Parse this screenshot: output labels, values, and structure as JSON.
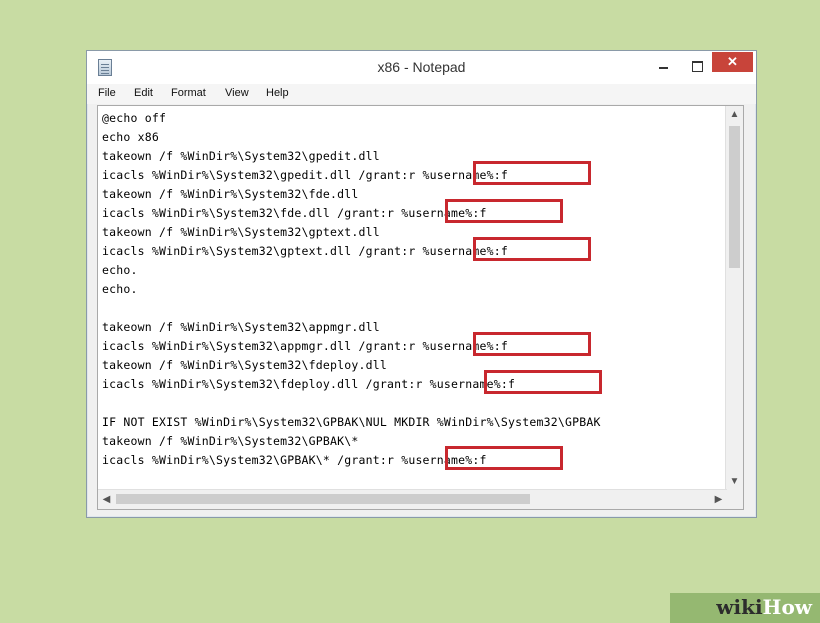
{
  "window": {
    "title": "x86 - Notepad",
    "close_glyph": "✕",
    "icons": [
      "notepad-icon",
      "minimize-icon",
      "maximize-icon",
      "close-icon"
    ]
  },
  "menu": [
    "File",
    "Edit",
    "Format",
    "View",
    "Help"
  ],
  "editor": {
    "lines": [
      "@echo off",
      "echo x86",
      "takeown /f %WinDir%\\System32\\gpedit.dll",
      "icacls %WinDir%\\System32\\gpedit.dll /grant:r %username%:f",
      "takeown /f %WinDir%\\System32\\fde.dll",
      "icacls %WinDir%\\System32\\fde.dll /grant:r %username%:f",
      "takeown /f %WinDir%\\System32\\gptext.dll",
      "icacls %WinDir%\\System32\\gptext.dll /grant:r %username%:f",
      "echo.",
      "echo.",
      "",
      "takeown /f %WinDir%\\System32\\appmgr.dll",
      "icacls %WinDir%\\System32\\appmgr.dll /grant:r %username%:f",
      "takeown /f %WinDir%\\System32\\fdeploy.dll",
      "icacls %WinDir%\\System32\\fdeploy.dll /grant:r %username%:f",
      "",
      "IF NOT EXIST %WinDir%\\System32\\GPBAK\\NUL MKDIR %WinDir%\\System32\\GPBAK",
      "takeown /f %WinDir%\\System32\\GPBAK\\*",
      "icacls %WinDir%\\System32\\GPBAK\\* /grant:r %username%:f"
    ],
    "highlight_color": "#c8282e"
  },
  "scrollbars": {
    "up": "▲",
    "down": "▼",
    "left": "◀",
    "right": "▶"
  },
  "watermark": {
    "wiki": "wiki",
    "how": "How"
  }
}
